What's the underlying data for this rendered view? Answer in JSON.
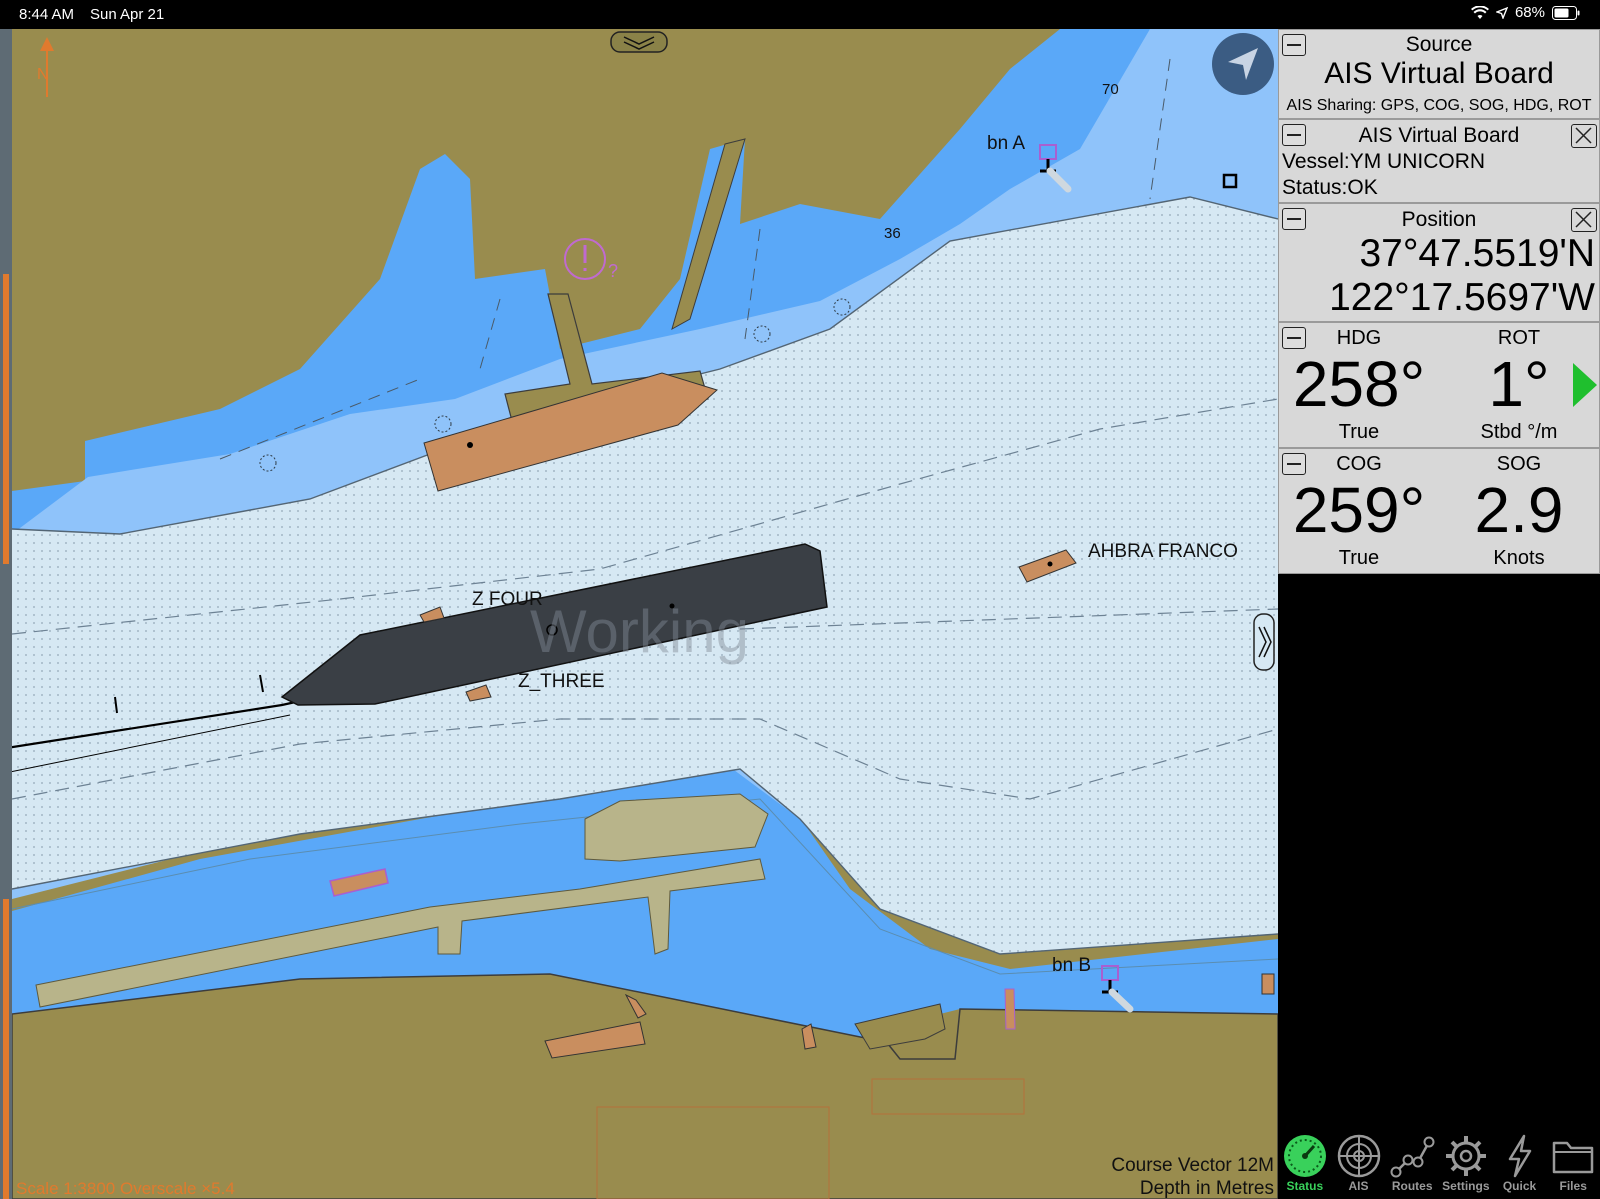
{
  "status_bar": {
    "time": "8:44 AM",
    "date": "Sun Apr 21",
    "battery": "68%"
  },
  "map": {
    "labels": {
      "bn_a": "bn A",
      "bn_b": "bn B",
      "vessel_ahbra": "AHBRA FRANCO",
      "vessel_z_four": "Z FOUR",
      "vessel_z_three": "Z_THREE",
      "watermark": "Working"
    },
    "depths": {
      "d70": "70",
      "d36": "36"
    },
    "scale_text": "Scale 1:3800 Overscale ×5.4",
    "course_vector": "Course Vector 12M",
    "depth_units": "Depth in Metres",
    "colors": {
      "land": "#998c4e",
      "shallow": "#5aa8f8",
      "medium": "#8fc3fa",
      "deep": "#d6e8f3",
      "own_vessel": "#3a3f45",
      "ais_target": "#c98e5f"
    }
  },
  "panel": {
    "source": {
      "title": "Source",
      "name": "AIS Virtual Board",
      "sharing": "AIS Sharing: GPS, COG, SOG, HDG, ROT"
    },
    "ais_board": {
      "title": "AIS Virtual Board",
      "vessel": "Vessel:YM UNICORN",
      "status": "Status:OK"
    },
    "position": {
      "title": "Position",
      "lat": "37°47.5519'N",
      "lon": "122°17.5697'W"
    },
    "hdg": {
      "label": "HDG",
      "value": "258°",
      "unit": "True"
    },
    "rot": {
      "label": "ROT",
      "value": "1°",
      "unit": "Stbd °/m",
      "indicator_color": "#1fbf2e"
    },
    "cog": {
      "label": "COG",
      "value": "259°",
      "unit": "True"
    },
    "sog": {
      "label": "SOG",
      "value": "2.9",
      "unit": "Knots"
    }
  },
  "tabs": [
    {
      "label": "Status",
      "icon": "gauge-icon",
      "active": true
    },
    {
      "label": "AIS",
      "icon": "radar-icon",
      "active": false
    },
    {
      "label": "Routes",
      "icon": "route-icon",
      "active": false
    },
    {
      "label": "Settings",
      "icon": "gear-icon",
      "active": false
    },
    {
      "label": "Quick",
      "icon": "lightning-icon",
      "active": false
    },
    {
      "label": "Files",
      "icon": "folder-icon",
      "active": false
    }
  ]
}
